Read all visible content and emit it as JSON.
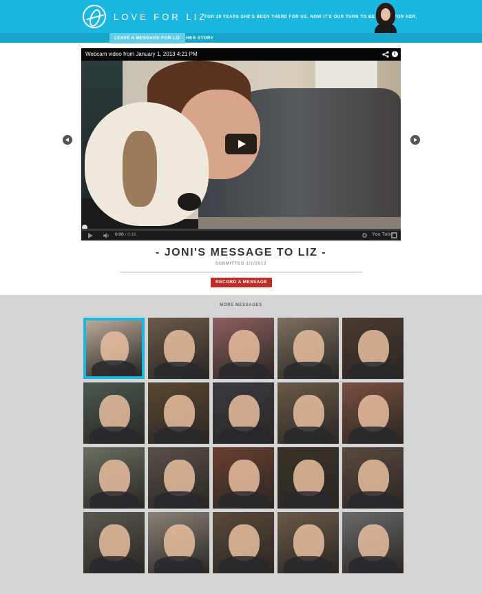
{
  "header": {
    "site_title": "LOVE FOR LIZ",
    "tagline": "FOR 29 YEARS SHE'S BEEN THERE FOR US. NOW IT'S OUR TURN TO BE THERE FOR HER.",
    "brand_color": "#1ab8e0"
  },
  "nav": {
    "tabs": [
      {
        "label": "LEAVE A MESSAGE FOR LIZ",
        "active": true
      },
      {
        "label": "HER STORY",
        "active": false
      }
    ]
  },
  "video": {
    "title": "Webcam video from January 1, 2013 4:21 PM",
    "current_time": "0:00",
    "duration": "/ 0:16",
    "youtube_label": "You Tube",
    "progress": 0
  },
  "message": {
    "title": "- JONI'S MESSAGE TO LIZ -",
    "submitted": "SUBMITTED 1/1/2013",
    "record_button": "RECORD A MESSAGE",
    "record_color": "#c12c25"
  },
  "more": {
    "title": "MORE MESSAGES",
    "thumbnails": [
      {
        "bg": "#b9a99a",
        "selected": true
      },
      {
        "bg": "#6b5a4a"
      },
      {
        "bg": "#8c6060"
      },
      {
        "bg": "#7c7060"
      },
      {
        "bg": "#4a3a30"
      },
      {
        "bg": "#4a5a50"
      },
      {
        "bg": "#5a4830"
      },
      {
        "bg": "#3a3a40"
      },
      {
        "bg": "#6a5a48"
      },
      {
        "bg": "#7a5040"
      },
      {
        "bg": "#6a7060"
      },
      {
        "bg": "#5a5048"
      },
      {
        "bg": "#6a4030"
      },
      {
        "bg": "#3a3228"
      },
      {
        "bg": "#5a4a40"
      },
      {
        "bg": "#5a5850"
      },
      {
        "bg": "#8a8278"
      },
      {
        "bg": "#5a4a3a"
      },
      {
        "bg": "#6a5a48"
      },
      {
        "bg": "#6a6a68"
      }
    ]
  }
}
